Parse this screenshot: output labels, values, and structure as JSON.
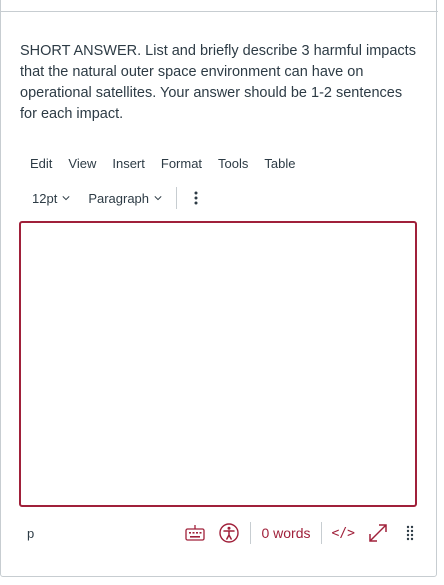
{
  "question": {
    "text": "SHORT ANSWER. List and briefly describe 3 harmful impacts that the natural outer space environment can have on operational satellites.  Your answer should be 1-2 sentences for each impact."
  },
  "menubar": {
    "items": [
      "Edit",
      "View",
      "Insert",
      "Format",
      "Tools",
      "Table"
    ]
  },
  "toolbar": {
    "font_size": "12pt",
    "block_format": "Paragraph",
    "more_icon": "kebab-vertical-icon"
  },
  "editor": {
    "content": ""
  },
  "statusbar": {
    "path": "p",
    "word_count": "0 words",
    "html_toggle": "</>",
    "icons": [
      "keyboard-icon",
      "accessibility-icon",
      "fullscreen-icon",
      "resize-grip-icon"
    ]
  },
  "colors": {
    "accent": "#a0203a",
    "text": "#2d3b45",
    "border": "#c7cdd1"
  }
}
